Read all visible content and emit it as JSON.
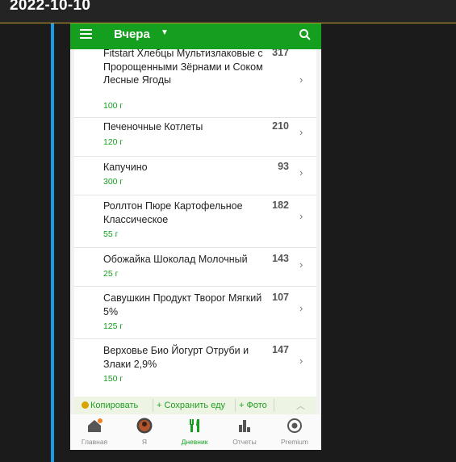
{
  "header": {
    "date": "2022-10-10"
  },
  "app": {
    "title": "Вчера",
    "icons": {
      "menu": "menu-icon",
      "search": "search-icon",
      "dropdown": "caret-down-icon"
    }
  },
  "diary": {
    "items": [
      {
        "name": "Fitstart Хлебцы Мультизлаковые с Пророщенными Зёрнами и Соком Лесные Ягоды",
        "weight": "100 г",
        "calories": "317"
      },
      {
        "name": "Печеночные Котлеты",
        "weight": "120 г",
        "calories": "210"
      },
      {
        "name": "Капучино",
        "weight": "300 г",
        "calories": "93"
      },
      {
        "name": "Роллтон Пюре Картофельное Классическое",
        "weight": "55 г",
        "calories": "182"
      },
      {
        "name": "Обожайка Шоколад Молочный",
        "weight": "25 г",
        "calories": "143"
      },
      {
        "name": "Савушкин Продукт Творог Мягкий 5%",
        "weight": "125 г",
        "calories": "107"
      },
      {
        "name": "Верховье Био Йогурт Отруби и Злаки 2,9%",
        "weight": "150 г",
        "calories": "147"
      }
    ]
  },
  "actions": {
    "copy": "Копировать",
    "save_meal": "+ Сохранить еду",
    "photo": "+ Фото"
  },
  "nav": {
    "home": "Главная",
    "me": "Я",
    "diary": "Дневник",
    "reports": "Отчеты",
    "premium": "Premium"
  },
  "colors": {
    "accent": "#14a01e",
    "weight_text": "#15a020",
    "side_line": "#1a9be6",
    "header_border": "#c8a030"
  }
}
